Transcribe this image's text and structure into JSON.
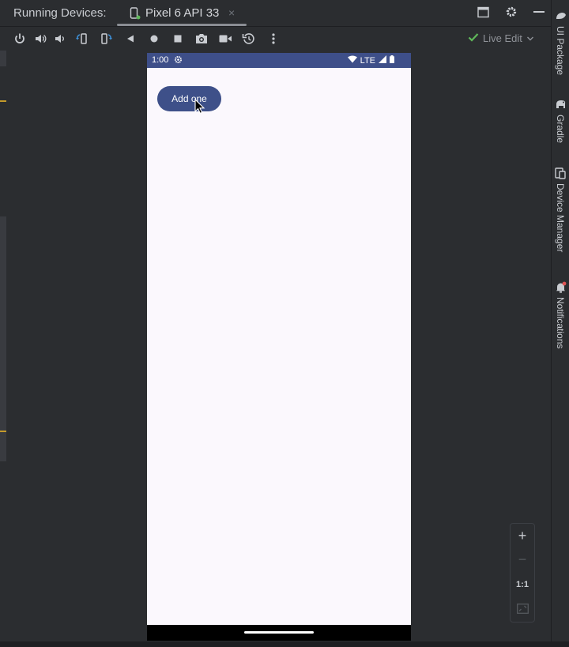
{
  "header": {
    "title": "Running Devices:",
    "device_tab": {
      "label": "Pixel 6 API 33",
      "close": "×"
    }
  },
  "toolbar": {
    "icons": [
      "power-icon",
      "volume-up-icon",
      "volume-down-icon",
      "rotate-left-icon",
      "rotate-right-icon",
      "back-icon",
      "home-icon",
      "overview-icon",
      "screenshot-icon",
      "screen-record-icon",
      "reset-icon",
      "more-icon"
    ],
    "live_edit": "Live Edit"
  },
  "phone": {
    "status": {
      "time": "1:00",
      "network": "LTE"
    },
    "button_label": "Add one"
  },
  "zoom": {
    "zoom_in": "+",
    "zoom_out": "−",
    "actual_size": "1:1"
  },
  "side_panel": {
    "items": [
      {
        "label": "UI Package"
      },
      {
        "label": "Gradle"
      },
      {
        "label": "Device Manager"
      },
      {
        "label": "Notifications"
      }
    ]
  },
  "colors": {
    "ide_bg": "#2b2d30",
    "status_bar": "#3e4f89",
    "button": "#3e5089",
    "phone_bg": "#fbf8fd",
    "accent_green": "#5fb85a",
    "accent_blue": "#3d8fd6"
  }
}
